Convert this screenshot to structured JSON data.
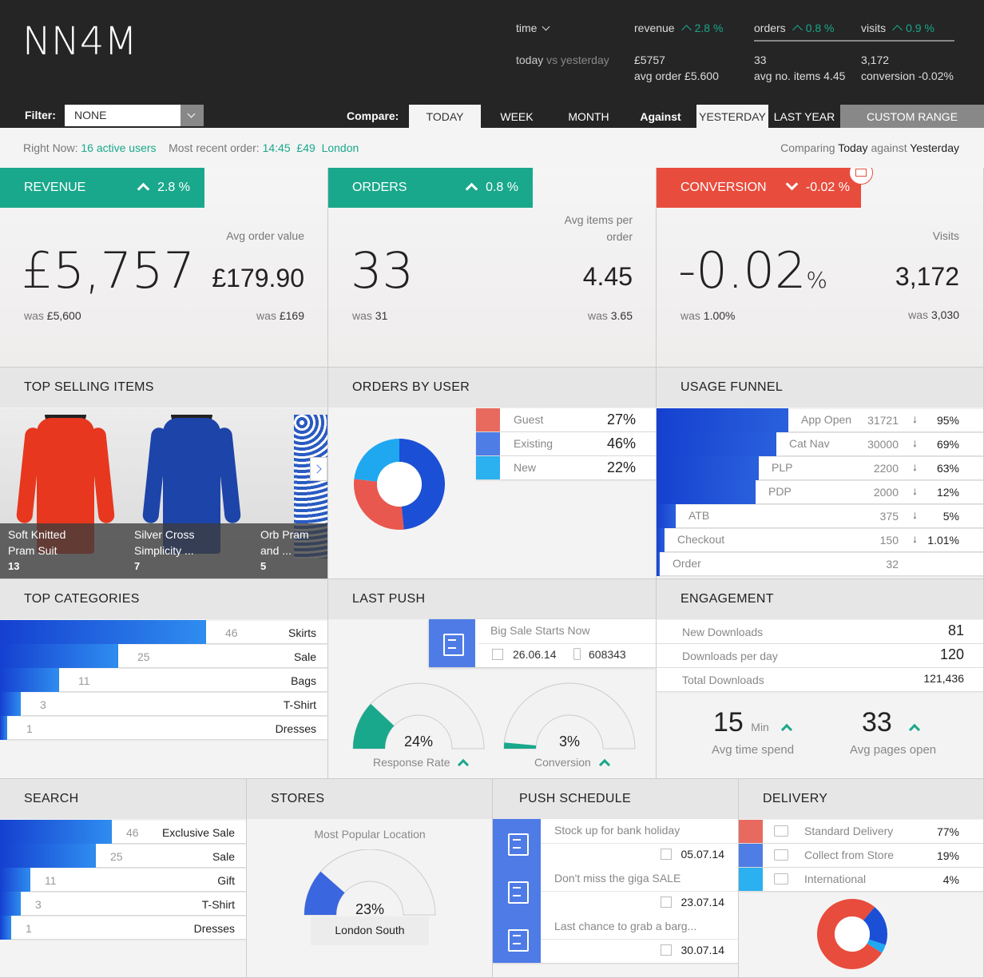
{
  "header": {
    "logo": "NN4M",
    "time_label": "time",
    "time_sub_a": "today",
    "time_sub_b": "vs yesterday",
    "revenue": {
      "label": "revenue",
      "change": "2.8 %",
      "value": "£5757",
      "sub": "avg order £5.600"
    },
    "orders": {
      "label": "orders",
      "change": "0.8 %",
      "value": "33",
      "sub": "avg no. items 4.45"
    },
    "visits": {
      "label": "visits",
      "change": "0.9 %",
      "value": "3,172",
      "sub": "conversion -0.02%"
    }
  },
  "toolbar": {
    "filter_label": "Filter:",
    "filter_value": "NONE",
    "compare_label": "Compare:",
    "today": "TODAY",
    "week": "WEEK",
    "month": "MONTH",
    "against_label": "Against",
    "yesterday": "YESTERDAY",
    "last_year": "LAST YEAR",
    "custom": "CUSTOM RANGE"
  },
  "status": {
    "right_now_label": "Right Now:",
    "active_users": "16 active users",
    "recent_label": "Most recent order:",
    "recent_time": "14:45",
    "recent_amount": "£49",
    "recent_location": "London",
    "comparing_a": "Comparing",
    "comparing_b": "Today",
    "comparing_c": "against",
    "comparing_d": "Yesterday"
  },
  "revenue_card": {
    "title": "REVENUE",
    "change": "2.8 %",
    "value": "£5,757",
    "was_label": "was",
    "was": "£5,600",
    "secondary_label": "Avg order value",
    "secondary": "£179.90",
    "secondary_was": "£169"
  },
  "orders_card": {
    "title": "ORDERS",
    "change": "0.8 %",
    "value": "33",
    "was_label": "was",
    "was": "31",
    "secondary_label_1": "Avg items per",
    "secondary_label_2": "order",
    "secondary": "4.45",
    "secondary_was": "3.65"
  },
  "conversion_card": {
    "title": "CONVERSION",
    "change": "-0.02 %",
    "value": "-0.02",
    "unit": "%",
    "was_label": "was",
    "was": "1.00%",
    "secondary_label": "Visits",
    "secondary": "3,172",
    "secondary_was": "3,030"
  },
  "top_selling": {
    "title": "TOP SELLING ITEMS",
    "items": [
      {
        "name1": "Soft Knitted",
        "name2": "Pram Suit",
        "count": "13",
        "color": "#e8371f"
      },
      {
        "name1": "Silver Cross",
        "name2": "Simplicity ...",
        "count": "7",
        "color": "#1d44a8"
      },
      {
        "name1": "Orb Pram",
        "name2": "and ...",
        "count": "5",
        "color": "#2a5bc2"
      }
    ]
  },
  "orders_by_user": {
    "title": "ORDERS BY USER",
    "rows": [
      {
        "label": "Guest",
        "value": "27%",
        "pct": 27,
        "color": "#e86a5e"
      },
      {
        "label": "Existing",
        "value": "46%",
        "pct": 46,
        "color": "#4f7de6"
      },
      {
        "label": "New",
        "value": "22%",
        "pct": 22,
        "color": "#2bb0f0"
      }
    ]
  },
  "usage_funnel": {
    "title": "USAGE FUNNEL",
    "rows": [
      {
        "label": "App Open",
        "count": "31721",
        "pct": "95%"
      },
      {
        "label": "Cat Nav",
        "count": "30000",
        "pct": "69%"
      },
      {
        "label": "PLP",
        "count": "2200",
        "pct": "63%"
      },
      {
        "label": "PDP",
        "count": "2000",
        "pct": "12%"
      },
      {
        "label": "ATB",
        "count": "375",
        "pct": "5%"
      },
      {
        "label": "Checkout",
        "count": "150",
        "pct": "1.01%"
      },
      {
        "label": "Order",
        "count": "32",
        "pct": ""
      }
    ]
  },
  "top_categories": {
    "title": "TOP CATEGORIES",
    "rows": [
      {
        "label": "Skirts",
        "count": "46"
      },
      {
        "label": "Sale",
        "count": "25"
      },
      {
        "label": "Bags",
        "count": "11"
      },
      {
        "label": "T-Shirt",
        "count": "3"
      },
      {
        "label": "Dresses",
        "count": "1"
      }
    ]
  },
  "last_push": {
    "title": "LAST PUSH",
    "message": "Big Sale Starts Now",
    "date": "26.06.14",
    "sent": "608343",
    "response_value": "24%",
    "response_label": "Response Rate",
    "response_pct": 24,
    "conversion_value": "3%",
    "conversion_label": "Conversion",
    "conversion_pct": 3
  },
  "engagement": {
    "title": "ENGAGEMENT",
    "rows": [
      {
        "label": "New Downloads",
        "value": "81"
      },
      {
        "label": "Downloads per day",
        "value": "120"
      },
      {
        "label": "Total Downloads",
        "value": "121,436"
      }
    ],
    "time_value": "15",
    "time_unit": "Min",
    "time_label": "Avg time spend",
    "pages_value": "33",
    "pages_label": "Avg pages open"
  },
  "search": {
    "title": "SEARCH",
    "rows": [
      {
        "label": "Exclusive Sale",
        "count": "46"
      },
      {
        "label": "Sale",
        "count": "25"
      },
      {
        "label": "Gift",
        "count": "11"
      },
      {
        "label": "T-Shirt",
        "count": "3"
      },
      {
        "label": "Dresses",
        "count": "1"
      }
    ]
  },
  "stores": {
    "title": "STORES",
    "subtitle": "Most Popular Location",
    "value": "23%",
    "pct": 23,
    "location": "London South"
  },
  "push_schedule": {
    "title": "PUSH SCHEDULE",
    "rows": [
      {
        "message": "Stock up for bank holiday",
        "date": "05.07.14"
      },
      {
        "message": "Don't miss the giga SALE",
        "date": "23.07.14"
      },
      {
        "message": "Last chance to grab a barg...",
        "date": "30.07.14"
      }
    ]
  },
  "delivery": {
    "title": "DELIVERY",
    "rows": [
      {
        "label": "Standard Delivery",
        "value": "77%",
        "pct": 77,
        "color": "#e86a5e"
      },
      {
        "label": "Collect from Store",
        "value": "19%",
        "pct": 19,
        "color": "#4f7de6"
      },
      {
        "label": "International",
        "value": "4%",
        "pct": 4,
        "color": "#2bb0f0"
      }
    ]
  },
  "colors": {
    "teal": "#1aa88c",
    "red": "#e84c3d",
    "blue": "#1b4fd6"
  }
}
